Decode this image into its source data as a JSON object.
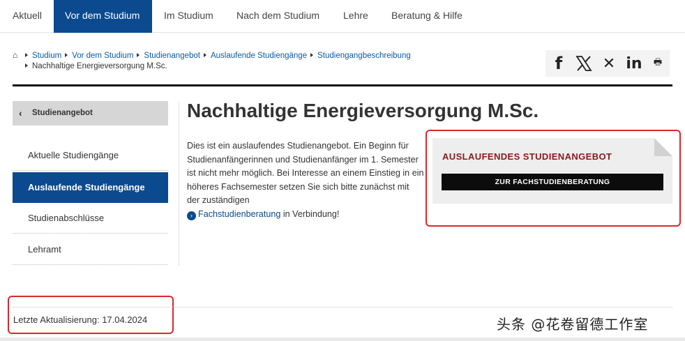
{
  "topnav": {
    "items": [
      {
        "label": "Aktuell",
        "active": false
      },
      {
        "label": "Vor dem Studium",
        "active": true
      },
      {
        "label": "Im Studium",
        "active": false
      },
      {
        "label": "Nach dem Studium",
        "active": false
      },
      {
        "label": "Lehre",
        "active": false
      },
      {
        "label": "Beratung & Hilfe",
        "active": false
      }
    ]
  },
  "breadcrumb": {
    "home_icon": "home-icon",
    "items": [
      "Studium",
      "Vor dem Studium",
      "Studienangebot",
      "Auslaufende Studiengänge",
      "Studiengangbeschreibung"
    ],
    "current": "Nachhaltige Energieversorgung M.Sc."
  },
  "share": {
    "icons": [
      "facebook-icon",
      "x-icon",
      "xing-icon",
      "linkedin-icon",
      "print-icon"
    ],
    "facebook": "f",
    "xing": "✕",
    "linkedin": "in",
    "print": "🖶"
  },
  "sidebar": {
    "header": "Studienangebot",
    "items": [
      {
        "label": "Aktuelle Studiengänge",
        "active": false
      },
      {
        "label": "Auslaufende Studiengänge",
        "active": true
      },
      {
        "label": "Studienabschlüsse",
        "active": false
      },
      {
        "label": "Lehramt",
        "active": false
      }
    ]
  },
  "main": {
    "title": "Nachhaltige Energieversorgung M.Sc.",
    "text": "Dies ist ein auslaufendes Studienangebot. Ein Beginn für Studienanfängerinnen und Studienanfänger im 1. Semester ist nicht mehr möglich. Bei Interesse an einem Einstieg in ein höheres Fachsemester setzen Sie sich bitte zunächst mit der zuständigen",
    "link": "Fachstudienberatung",
    "text_end": " in Verbindung!"
  },
  "infobox": {
    "heading": "AUSLAUFENDES STUDIENANGEBOT",
    "button": "ZUR FACHSTUDIENBERATUNG"
  },
  "footer": {
    "updated": "Letzte Aktualisierung: 17.04.2024"
  },
  "watermark": "头条 @花卷留德工作室",
  "colors": {
    "brand_blue": "#0b4a8f",
    "highlight_red": "#d8282b",
    "heading_red": "#8b1a1a"
  }
}
